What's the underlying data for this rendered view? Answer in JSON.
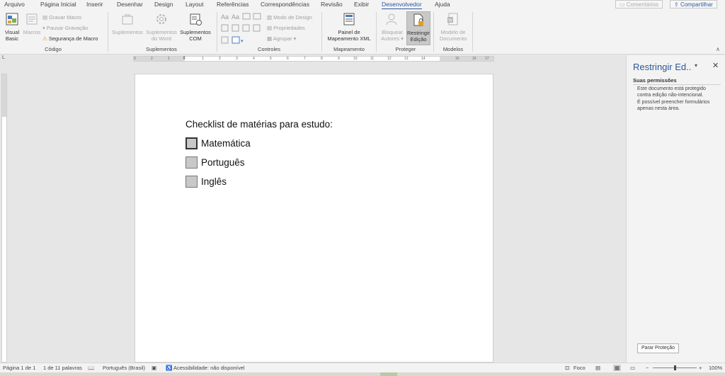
{
  "tabs": [
    "Arquivo",
    "Página Inicial",
    "Inserir",
    "Desenhar",
    "Design",
    "Layout",
    "Referências",
    "Correspondências",
    "Revisão",
    "Exibir",
    "Desenvolvedor",
    "Ajuda"
  ],
  "active_tab": "Desenvolvedor",
  "top_buttons": {
    "comments": "Comentários",
    "share": "Compartilhar"
  },
  "ribbon": {
    "codigo": {
      "label": "Código",
      "visual_basic": [
        "Visual",
        "Basic"
      ],
      "macros": "Macros",
      "record_macro": "Gravar Macro",
      "pause_recording": "Pausar Gravação",
      "macro_security": "Segurança de Macro"
    },
    "suplementos": {
      "label": "Suplementos",
      "addins": "Suplementos",
      "word_addins": [
        "Suplementos",
        "do Word"
      ],
      "com_addins": [
        "Suplementos",
        "COM"
      ]
    },
    "controles": {
      "label": "Controles",
      "design_mode": "Modo de Design",
      "properties": "Propriedades",
      "group": "Agrupar"
    },
    "mapeamento": {
      "label": "Mapeamento",
      "xml_panel": [
        "Painel de",
        "Mapeamento XML"
      ]
    },
    "proteger": {
      "label": "Proteger",
      "block_authors": [
        "Bloquear",
        "Autores"
      ],
      "restrict_editing": [
        "Restringir",
        "Edição"
      ]
    },
    "modelos": {
      "label": "Modelos",
      "document_template": [
        "Modelo de",
        "Documento"
      ]
    }
  },
  "ruler_numbers": [
    "3",
    "2",
    "1",
    "1",
    "2",
    "3",
    "4",
    "5",
    "6",
    "7",
    "8",
    "9",
    "10",
    "11",
    "12",
    "13",
    "14",
    "15",
    "16",
    "17"
  ],
  "document": {
    "title": "Checklist de matérias para estudo:",
    "items": [
      {
        "label": "Matemática",
        "checked": false
      },
      {
        "label": "Português",
        "checked": false
      },
      {
        "label": "Inglês",
        "checked": false
      }
    ]
  },
  "pane": {
    "title": "Restringir Ed..",
    "permissions_heading": "Suas permissões",
    "protected_text": "Este documento está protegido contra edição não-intencional.",
    "forms_text": "É possível preencher formulários apenas nesta área.",
    "stop_protection": "Parar Proteção"
  },
  "status": {
    "page": "Página 1 de 1",
    "words": "1 de 11 palavras",
    "language": "Português (Brasil)",
    "accessibility": "Acessibilidade: não disponível",
    "focus": "Foco",
    "zoom": "100%"
  },
  "colors": {
    "accent": "#2b579a",
    "ribbon_bg": "#f3f3f3",
    "canvas_bg": "#e6e6e6",
    "checkbox_fill": "#c8c8c8"
  }
}
